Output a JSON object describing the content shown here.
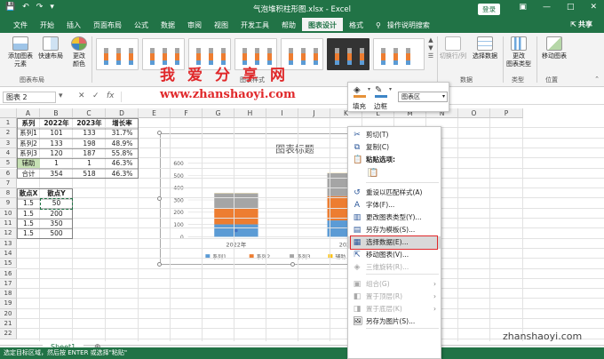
{
  "window": {
    "title": "气泡堆积柱形图.xlsx - Excel",
    "login": "登录"
  },
  "tabs": [
    "文件",
    "开始",
    "插入",
    "页面布局",
    "公式",
    "数据",
    "审阅",
    "视图",
    "开发工具",
    "帮助",
    "图表设计",
    "格式"
  ],
  "active_tab": "图表设计",
  "tell_me": "操作说明搜索",
  "share": "共享",
  "ribbon": {
    "add_element": "添加图表\n元素",
    "quick_layout": "快速布局",
    "change_color": "更改\n颜色",
    "group_layout": "图表布局",
    "group_styles": "图表样式",
    "switch_row_col": "切换行/列",
    "select_data": "选择数据",
    "group_data": "数据",
    "change_type": "更改\n图表类型",
    "group_type": "类型",
    "move_chart": "移动图表",
    "group_location": "位置"
  },
  "namebox": "图表 2",
  "columns": [
    "A",
    "B",
    "C",
    "D",
    "E",
    "F",
    "G",
    "H",
    "I",
    "J",
    "K",
    "L",
    "M",
    "N",
    "O",
    "P"
  ],
  "rows": [
    "1",
    "2",
    "3",
    "4",
    "5",
    "6",
    "7",
    "8",
    "9",
    "10",
    "11",
    "12",
    "13",
    "14",
    "15",
    "16",
    "17",
    "18",
    "19",
    "20",
    "21",
    "22"
  ],
  "table1": {
    "header": [
      "系列",
      "2022年",
      "2023年",
      "增长率"
    ],
    "rows": [
      [
        "系列1",
        "101",
        "133",
        "31.7%"
      ],
      [
        "系列2",
        "133",
        "198",
        "48.9%"
      ],
      [
        "系列3",
        "120",
        "187",
        "55.8%"
      ],
      [
        "辅助",
        "1",
        "1",
        "46.3%"
      ],
      [
        "合计",
        "354",
        "518",
        "46.3%"
      ]
    ]
  },
  "table2": {
    "header": [
      "散点X",
      "散点Y"
    ],
    "rows": [
      [
        "1.5",
        "50"
      ],
      [
        "1.5",
        "200"
      ],
      [
        "1.5",
        "350"
      ],
      [
        "1.5",
        "500"
      ]
    ]
  },
  "chart_data": {
    "type": "bar",
    "title": "图表标题",
    "categories": [
      "2022年",
      "2023年"
    ],
    "series": [
      {
        "name": "系列1",
        "values": [
          101,
          133
        ]
      },
      {
        "name": "系列2",
        "values": [
          133,
          198
        ]
      },
      {
        "name": "系列3",
        "values": [
          120,
          187
        ]
      },
      {
        "name": "辅助",
        "values": [
          1,
          1
        ]
      }
    ],
    "scatter": {
      "name": "散点Y"
    },
    "ylim": [
      0,
      600
    ],
    "yticks": [
      "0",
      "100",
      "200",
      "300",
      "400",
      "500",
      "600"
    ],
    "grid": true,
    "legend": "bottom",
    "colors": [
      "#5b9bd5",
      "#ed7d31",
      "#a5a5a5",
      "#ffc000"
    ]
  },
  "minibar": {
    "fill": "填充",
    "outline": "边框",
    "area": "图表区"
  },
  "context_menu": [
    {
      "label": "剪切(T)",
      "icon": "scissors-icon"
    },
    {
      "label": "复制(C)",
      "icon": "copy-icon"
    },
    {
      "label": "粘贴选项:",
      "icon": "paste-icon"
    },
    {
      "label": "",
      "icon": "paste-option-icon"
    },
    {
      "label": "重设以匹配样式(A)",
      "icon": "reset-icon"
    },
    {
      "label": "字体(F)...",
      "icon": "font-icon"
    },
    {
      "label": "更改图表类型(Y)...",
      "icon": "chart-type-icon"
    },
    {
      "label": "另存为模板(S)...",
      "icon": "template-icon"
    },
    {
      "label": "选择数据(E)...",
      "icon": "select-data-icon"
    },
    {
      "label": "移动图表(V)...",
      "icon": "move-chart-icon"
    },
    {
      "label": "三维旋转(R)...",
      "icon": "rotate-icon"
    },
    {
      "label": "组合(G)",
      "icon": "group-icon"
    },
    {
      "label": "置于顶层(R)",
      "icon": "bring-front-icon"
    },
    {
      "label": "置于底层(K)",
      "icon": "send-back-icon"
    },
    {
      "label": "另存为图片(S)...",
      "icon": "save-picture-icon"
    }
  ],
  "sheet_tab": "Sheet1",
  "status": "选定目标区域，然后按 ENTER 或选择\"粘贴\"",
  "watermark": {
    "line1": "我爱分享网",
    "line2": "www.zhanshaoyi.com",
    "line3": "zhanshaoyi.com"
  }
}
